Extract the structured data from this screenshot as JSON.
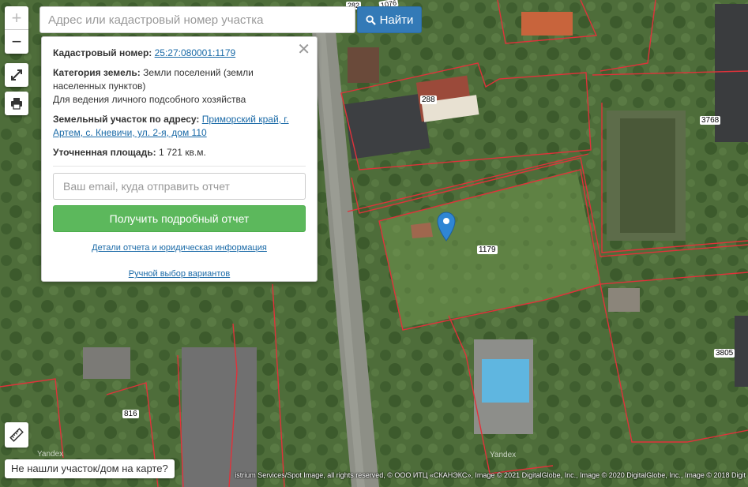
{
  "map": {
    "parcel_labels": [
      "288",
      "1179",
      "3768",
      "3805",
      "816"
    ],
    "partial_labels": [
      "282",
      "1076"
    ],
    "watermark": "Yandex",
    "copyright": "istrium Services/Spot Image, all rights reserved, © ООО ИТЦ «СКАНЭКС», Image © 2021 DigitalGlobe, Inc., Image © 2020 DigitalGlobe, Inc., Image © 2018 Digit",
    "boundary_color": "#e0323a",
    "marker_color": "#2f86d4"
  },
  "controls": {
    "zoom_in": "+",
    "zoom_out": "−",
    "fullscreen_icon": "expand-icon",
    "print_icon": "printer-icon",
    "ruler_icon": "ruler-icon"
  },
  "search": {
    "placeholder": "Адрес или кадастровый номер участка",
    "value": "",
    "button_label": "Найти"
  },
  "popup": {
    "cadastral_label": "Кадастровый номер:",
    "cadastral_value": "25:27:080001:1179",
    "category_label": "Категория земель:",
    "category_value": "Земли поселений (земли населенных пунктов)",
    "use": "Для ведения личного подсобного хозяйства",
    "address_label": "Земельный участок по адресу:",
    "address_value": "Приморский край, г. Артем, с. Кневичи, ул. 2-я, дом 110",
    "area_label": "Уточненная площадь:",
    "area_value": "1 721 кв.м.",
    "email_placeholder": "Ваш email, куда отправить отчет",
    "report_button": "Получить подробный отчет",
    "details_link": "Детали отчета и юридическая информация",
    "manual_link": "Ручной выбор вариантов"
  },
  "not_found_button": "Не нашли участок/дом на карте?"
}
